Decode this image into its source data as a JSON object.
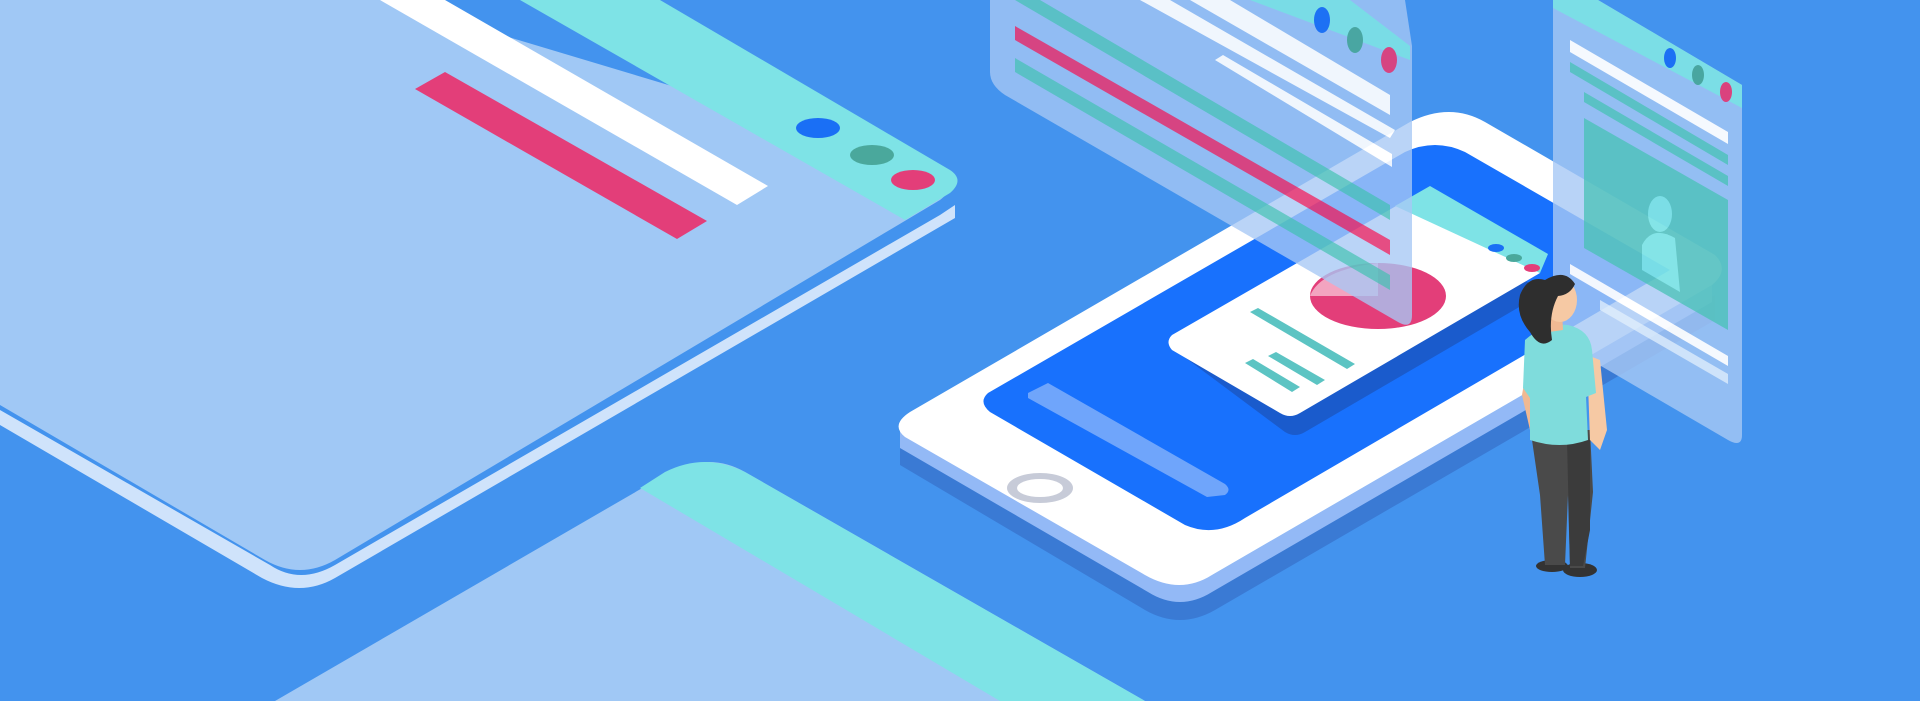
{
  "scene": {
    "description_tags": [
      "isometric-illustration",
      "smartphone",
      "floating-browser-windows",
      "person-viewing-phone"
    ]
  },
  "colors": {
    "background": "#4393ee",
    "panel_light": "#a0c8f5",
    "panel_edge": "#d6e8fb",
    "teal": "#7ee3e6",
    "teal_dark": "#5cc4c3",
    "white": "#ffffff",
    "phone_screen": "#1871fd",
    "pink": "#e33e79",
    "dot_blue": "#1a6ff5",
    "dot_teal": "#4aa89c",
    "shirt": "#7fdcdc",
    "pants": "#4a4a4a",
    "skin": "#f6c9a4",
    "hair": "#2e2e2e"
  },
  "windows": [
    {
      "name": "large-browser-window",
      "dots": [
        "blue",
        "teal",
        "pink"
      ]
    },
    {
      "name": "floating-text-window",
      "dots": [
        "blue",
        "teal",
        "pink"
      ]
    },
    {
      "name": "floating-profile-window",
      "dots": [
        "blue",
        "teal",
        "pink"
      ]
    },
    {
      "name": "phone-card-window",
      "dots": [
        "blue",
        "teal",
        "pink"
      ]
    }
  ],
  "icons": [
    "user-profile-icon",
    "home-button-icon",
    "pie-chart-icon"
  ]
}
